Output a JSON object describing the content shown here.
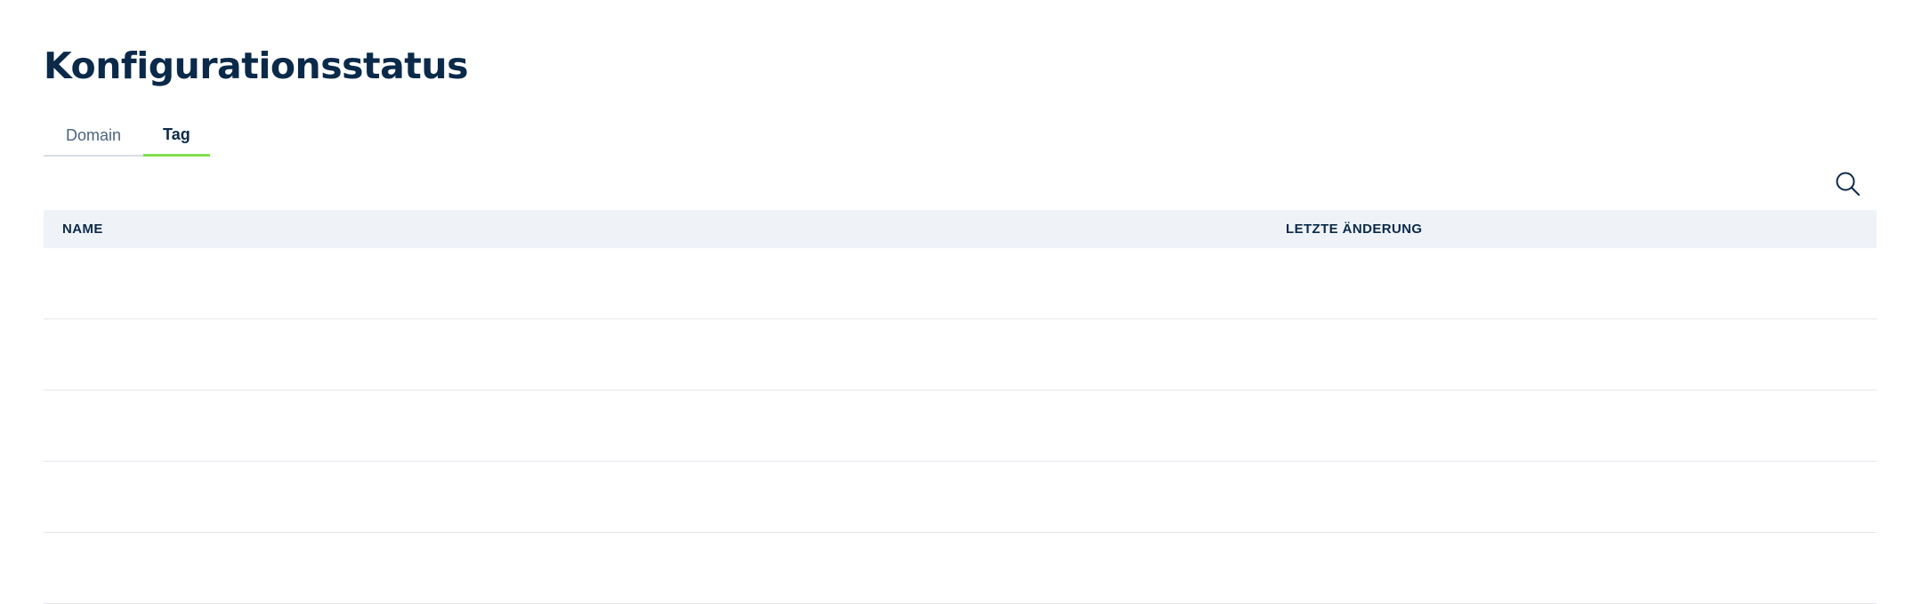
{
  "page": {
    "title": "Konfigurationsstatus"
  },
  "tabs": [
    {
      "label": "Domain",
      "active": false
    },
    {
      "label": "Tag",
      "active": true
    }
  ],
  "toolbar": {
    "search_icon": "search-icon"
  },
  "table": {
    "columns": [
      "NAME",
      "LETZTE ÄNDERUNG"
    ],
    "rows": [
      [
        "",
        ""
      ],
      [
        "",
        ""
      ],
      [
        "",
        ""
      ],
      [
        "",
        ""
      ],
      [
        "",
        ""
      ]
    ]
  },
  "colors": {
    "title": "#0b2a4a",
    "tab_active_underline": "#7ee04f",
    "header_background": "#eff3f8"
  }
}
